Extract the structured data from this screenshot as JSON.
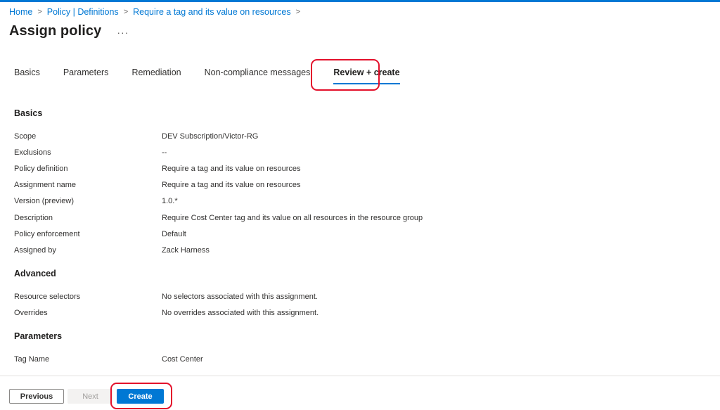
{
  "breadcrumb": {
    "items": [
      "Home",
      "Policy | Definitions",
      "Require a tag and its value on resources"
    ],
    "separator": ">"
  },
  "header": {
    "title": "Assign policy",
    "more": "···"
  },
  "tabs": [
    {
      "label": "Basics",
      "active": false
    },
    {
      "label": "Parameters",
      "active": false
    },
    {
      "label": "Remediation",
      "active": false
    },
    {
      "label": "Non-compliance messages",
      "active": false
    },
    {
      "label": "Review + create",
      "active": true
    }
  ],
  "sections": {
    "basics": {
      "heading": "Basics",
      "rows": [
        {
          "label": "Scope",
          "value": "DEV Subscription/Victor-RG"
        },
        {
          "label": "Exclusions",
          "value": "--"
        },
        {
          "label": "Policy definition",
          "value": "Require a tag and its value on resources"
        },
        {
          "label": "Assignment name",
          "value": "Require a tag and its value on resources"
        },
        {
          "label": "Version (preview)",
          "value": "1.0.*"
        },
        {
          "label": "Description",
          "value": "Require Cost Center tag and its value on all resources in the resource group"
        },
        {
          "label": "Policy enforcement",
          "value": "Default"
        },
        {
          "label": "Assigned by",
          "value": "Zack Harness"
        }
      ]
    },
    "advanced": {
      "heading": "Advanced",
      "rows": [
        {
          "label": "Resource selectors",
          "value": "No selectors associated with this assignment."
        },
        {
          "label": "Overrides",
          "value": "No overrides associated with this assignment."
        }
      ]
    },
    "parameters": {
      "heading": "Parameters",
      "rows": [
        {
          "label": "Tag Name",
          "value": "Cost Center"
        }
      ]
    }
  },
  "footer": {
    "previous": "Previous",
    "next": "Next",
    "create": "Create"
  },
  "colors": {
    "accent": "#0078d4",
    "highlight": "#e3102b",
    "text": "#323130"
  }
}
